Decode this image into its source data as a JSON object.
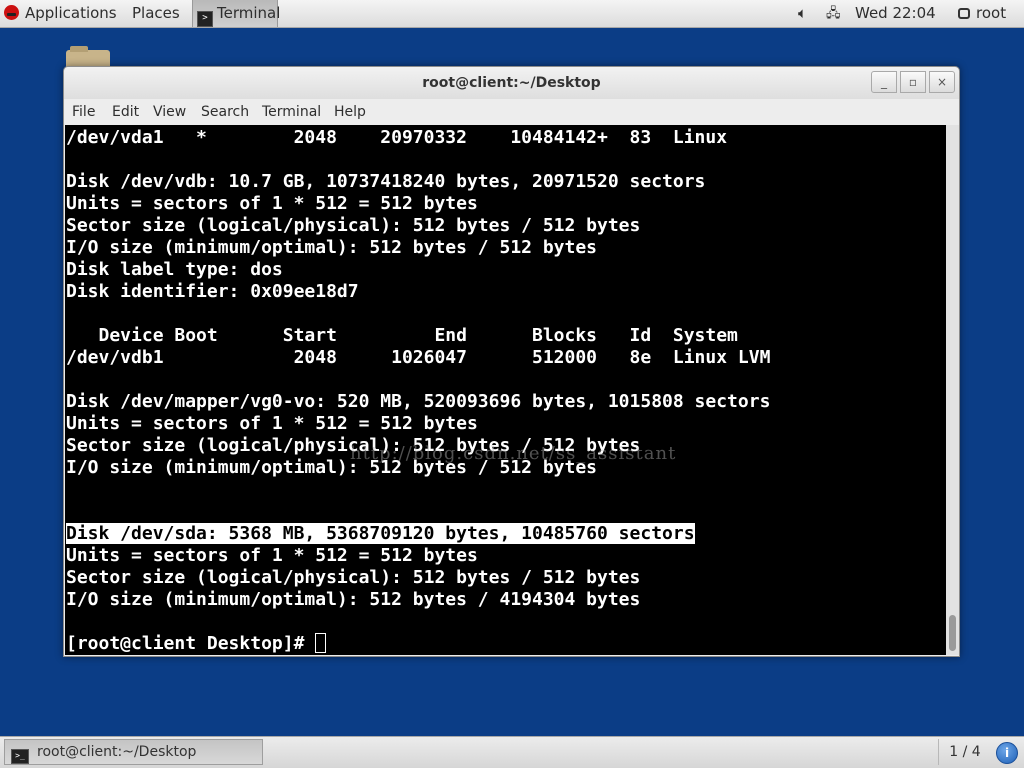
{
  "top_panel": {
    "applications": "Applications",
    "places": "Places",
    "terminal_task": "Terminal",
    "clock": "Wed 22:04",
    "user": "root"
  },
  "window": {
    "title": "root@client:~/Desktop",
    "controls": {
      "minimize": "_",
      "maximize": "▫",
      "close": "×"
    },
    "menus": [
      "File",
      "Edit",
      "View",
      "Search",
      "Terminal",
      "Help"
    ]
  },
  "terminal": {
    "lines_before": [
      "/dev/vda1   *        2048    20970332    10484142+  83  Linux",
      "",
      "Disk /dev/vdb: 10.7 GB, 10737418240 bytes, 20971520 sectors",
      "Units = sectors of 1 * 512 = 512 bytes",
      "Sector size (logical/physical): 512 bytes / 512 bytes",
      "I/O size (minimum/optimal): 512 bytes / 512 bytes",
      "Disk label type: dos",
      "Disk identifier: 0x09ee18d7",
      "",
      "   Device Boot      Start         End      Blocks   Id  System",
      "/dev/vdb1            2048     1026047      512000   8e  Linux LVM",
      "",
      "Disk /dev/mapper/vg0-vo: 520 MB, 520093696 bytes, 1015808 sectors",
      "Units = sectors of 1 * 512 = 512 bytes",
      "Sector size (logical/physical): 512 bytes / 512 bytes",
      "I/O size (minimum/optimal): 512 bytes / 512 bytes",
      "",
      ""
    ],
    "highlighted_line": "Disk /dev/sda: 5368 MB, 5368709120 bytes, 10485760 sectors",
    "lines_after": [
      "Units = sectors of 1 * 512 = 512 bytes",
      "Sector size (logical/physical): 512 bytes / 512 bytes",
      "I/O size (minimum/optimal): 512 bytes / 4194304 bytes",
      ""
    ],
    "prompt": "[root@client Desktop]# ",
    "watermark": "http://blog.csdn.net/ss_assistant"
  },
  "bottom_panel": {
    "task_label": "root@client:~/Desktop",
    "workspace": "1 / 4"
  },
  "colors": {
    "desktop": "#0b3d86",
    "terminal_bg": "#000000",
    "terminal_fg": "#ffffff"
  }
}
